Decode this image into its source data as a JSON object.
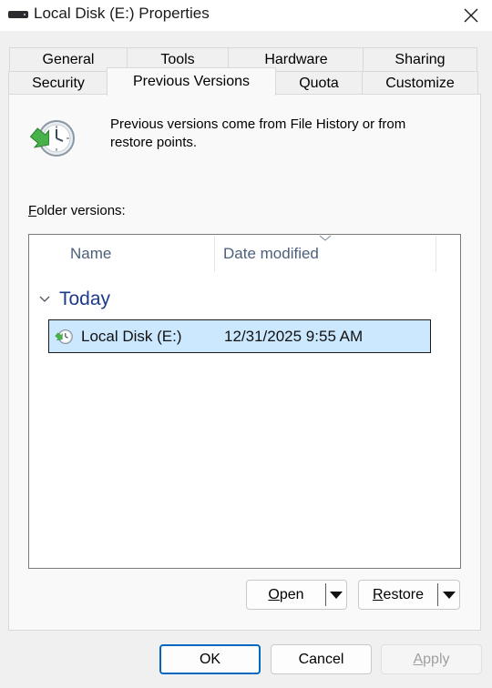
{
  "window": {
    "title": "Local Disk (E:) Properties"
  },
  "tabs": {
    "row1": [
      "General",
      "Tools",
      "Hardware",
      "Sharing"
    ],
    "row2": [
      "Security",
      "Previous Versions",
      "Quota",
      "Customize"
    ],
    "selected": "Previous Versions"
  },
  "info": {
    "line1": "Previous versions come from File History or from",
    "line2": "restore points."
  },
  "folder_versions": {
    "label_mnemonic": "F",
    "label_rest": "older versions:",
    "columns": [
      "Name",
      "Date modified"
    ],
    "groups": [
      {
        "name": "Today",
        "items": [
          {
            "name": "Local Disk (E:)",
            "date_modified": "12/31/2025 9:55 AM",
            "selected": true
          }
        ]
      }
    ]
  },
  "actions": {
    "open_mnemonic": "O",
    "open_rest": "pen",
    "restore_mnemonic": "R",
    "restore_rest": "estore"
  },
  "footer": {
    "ok": "OK",
    "cancel": "Cancel",
    "apply_mnemonic": "A",
    "apply_rest": "pply"
  },
  "colors": {
    "selection_bg": "#cce8ff",
    "default_button_border": "#0067c0",
    "group_header": "#1e3a8a",
    "column_header": "#4c607a"
  },
  "icons": [
    "drive-icon",
    "close-icon",
    "clock-restore-icon",
    "chevron-down-icon",
    "sort-arrow-icon",
    "dropdown-arrow-icon"
  ]
}
